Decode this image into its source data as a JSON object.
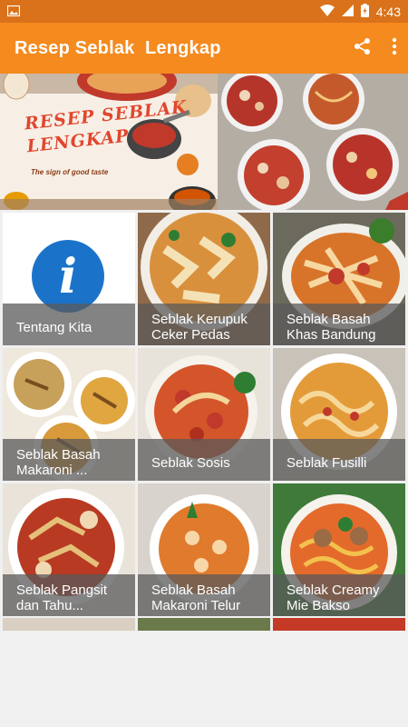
{
  "status_bar": {
    "time": "4:43",
    "icons": [
      "gallery-notification-icon",
      "wifi-icon",
      "signal-icon",
      "battery-charging-icon"
    ]
  },
  "app_bar": {
    "title": "Resep Seblak  Lengkap",
    "actions": [
      "share-icon",
      "overflow-menu-icon"
    ]
  },
  "banner": {
    "logo_title_line1": "RESEP SEBLAK",
    "logo_title_line2": "LENGKAP",
    "logo_tagline": "The sign of good taste"
  },
  "colors": {
    "status_bar": "#d9721a",
    "app_bar": "#f58a1f",
    "info_blue": "#1a73c9"
  },
  "menu": {
    "items": [
      {
        "label": "Tentang Kita",
        "icon": "info-icon"
      },
      {
        "label": "Seblak Kerupuk Ceker Pedas"
      },
      {
        "label": "Seblak Basah Khas Bandung"
      },
      {
        "label": "Seblak Basah Makaroni ..."
      },
      {
        "label": "Seblak Sosis"
      },
      {
        "label": "Seblak Fusilli"
      },
      {
        "label": "Seblak Pangsit dan Tahu..."
      },
      {
        "label": "Seblak Basah Makaroni Telur"
      },
      {
        "label": "Seblak Creamy Mie Bakso"
      }
    ]
  }
}
